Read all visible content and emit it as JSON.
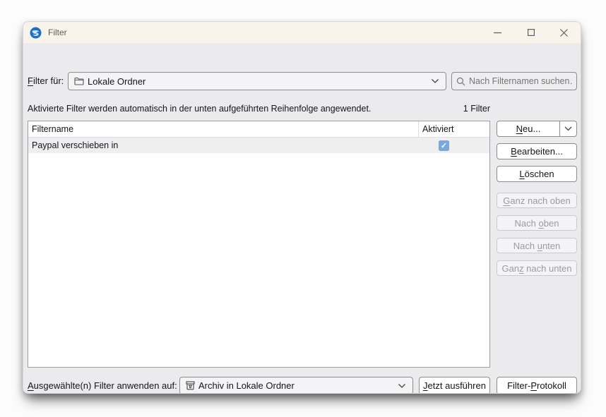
{
  "window": {
    "title": "Filter"
  },
  "toolbar": {
    "filter_for_label": {
      "key": "F",
      "post": "ilter für:"
    },
    "filter_for_value": "Lokale Ordner",
    "search_placeholder": "Nach Filternamen suchen…"
  },
  "description": {
    "text": "Aktivierte Filter werden automatisch in der unten aufgeführten Reihenfolge angewendet.",
    "count": "1 Filter"
  },
  "table": {
    "columns": {
      "name": "Filtername",
      "active": "Aktiviert"
    },
    "rows": [
      {
        "name": "Paypal verschieben in",
        "enabled": true
      }
    ]
  },
  "buttons": {
    "new": {
      "key": "N",
      "post": "eu..."
    },
    "edit": {
      "key": "B",
      "post": "earbeiten..."
    },
    "delete": {
      "key": "L",
      "post": "öschen"
    },
    "move_top": {
      "key": "G",
      "post": "anz nach oben"
    },
    "move_up": {
      "pre": "Nach ",
      "key": "o",
      "post": "ben"
    },
    "move_down": {
      "pre": "Nach ",
      "key": "u",
      "post": "nten"
    },
    "move_bottom": {
      "pre": "Gan",
      "key": "z",
      "post": " nach unten"
    },
    "run_now": {
      "key": "J",
      "post": "etzt ausführen"
    },
    "filter_log": {
      "pre": "Filter-",
      "key": "P",
      "post": "rotokoll"
    }
  },
  "footer": {
    "apply_label": {
      "key": "A",
      "post": "usgewählte(n) Filter anwenden auf:"
    },
    "apply_value": "Archiv in Lokale Ordner"
  },
  "icons": {
    "check": "✓",
    "app_logo": "thunderbird-logo",
    "folder": "folder-icon",
    "archive": "archive-icon",
    "search": "magnifier",
    "chevron": "chevron-down"
  },
  "colors": {
    "titlebar_bg": "#f8f4eb",
    "dialog_bg": "#ebebee",
    "checkbox_fill": "#74aade",
    "row_bg": "#efeff1",
    "button_border": "#8d8d8d",
    "disabled_text": "#9b9b9f",
    "logo_blue": "#1b6ec9"
  }
}
